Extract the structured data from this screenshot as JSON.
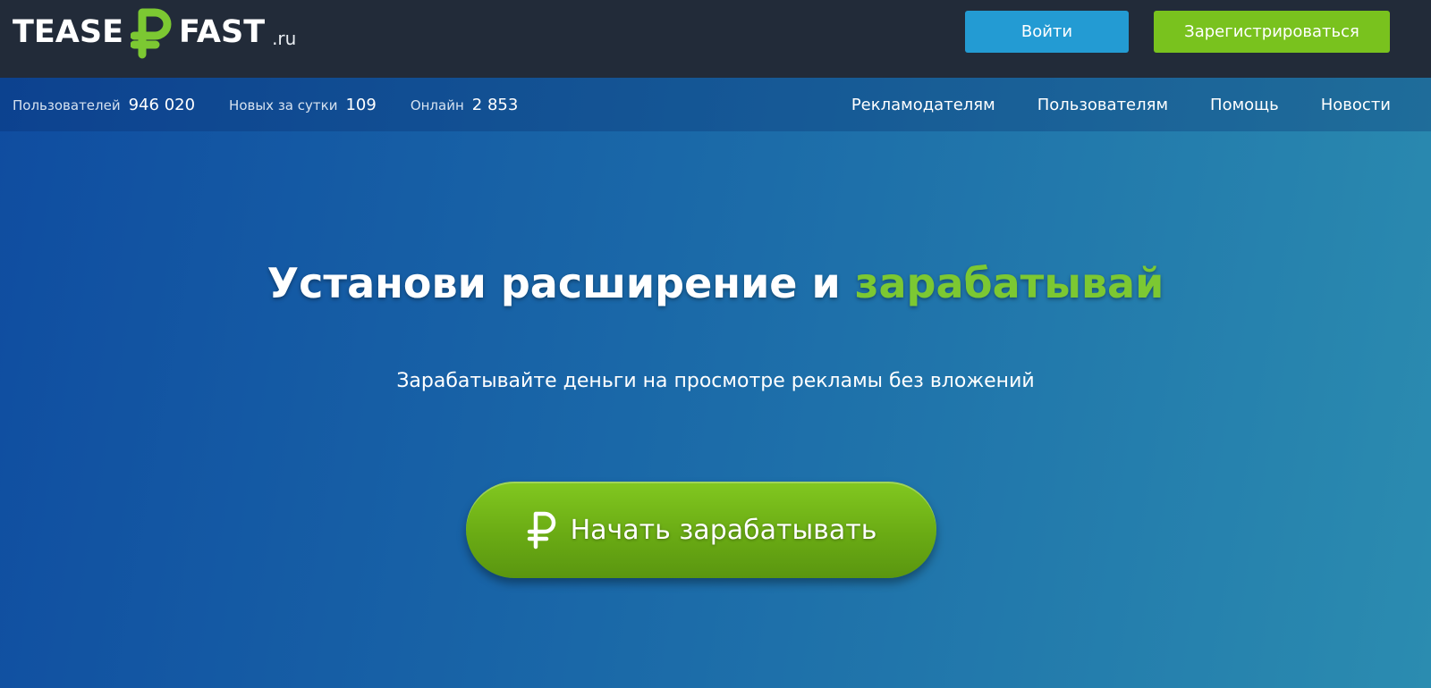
{
  "header": {
    "logo": {
      "word_left": "TEASE",
      "icon": "ruble-logo-icon",
      "word_right": "FAST",
      "tld": ".ru"
    },
    "login_label": "Войти",
    "register_label": "Зарегистрироваться"
  },
  "stats": [
    {
      "label": "Пользователей",
      "value": "946 020"
    },
    {
      "label": "Новых за сутки",
      "value": "109"
    },
    {
      "label": "Онлайн",
      "value": "2 853"
    }
  ],
  "nav": [
    {
      "label": "Рекламодателям"
    },
    {
      "label": "Пользователям"
    },
    {
      "label": "Помощь"
    },
    {
      "label": "Новости"
    }
  ],
  "hero": {
    "title_main": "Установи расширение и",
    "title_accent": "зарабатывай",
    "subtitle": "Зарабатывайте деньги на просмотре рекламы без вложений",
    "cta_label": "Начать зарабатывать",
    "cta_icon": "ruble-icon"
  },
  "colors": {
    "header_bg": "#222b39",
    "login_btn": "#239bd3",
    "register_btn": "#79c21e",
    "accent_green": "#7cc832",
    "hero_gradient_start": "#0f4ca0",
    "hero_gradient_end": "#2b8cb0"
  }
}
